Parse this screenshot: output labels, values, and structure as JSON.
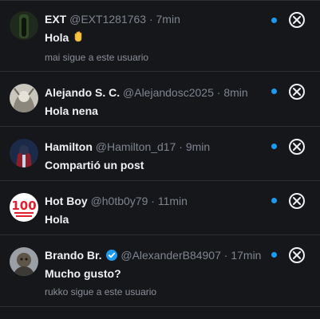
{
  "notifications": [
    {
      "name": "EXT",
      "handle": "@EXT1281763",
      "time": "· 7min",
      "message": "Hola",
      "sub": "mai sigue a este usuario"
    },
    {
      "name": "Alejando S. C.",
      "handle": "@Alejandosc2025",
      "time": "· 8min",
      "message": "Hola nena",
      "sub": ""
    },
    {
      "name": "Hamilton",
      "handle": "@Hamilton_d17",
      "time": "· 9min",
      "message": "Compartió un post",
      "sub": ""
    },
    {
      "name": "Hot Boy",
      "handle": "@h0tb0y79",
      "time": "· 11min",
      "message": "Hola",
      "sub": ""
    },
    {
      "name": "Brando Br.",
      "handle": "@AlexanderB84907",
      "time": "· 17min",
      "message": "Mucho gusto?",
      "sub": "rukko sigue a este usuario"
    }
  ],
  "colors": {
    "background": "#15171b",
    "unread_dot": "#1d9bf0",
    "verified": "#1d9bf0"
  }
}
